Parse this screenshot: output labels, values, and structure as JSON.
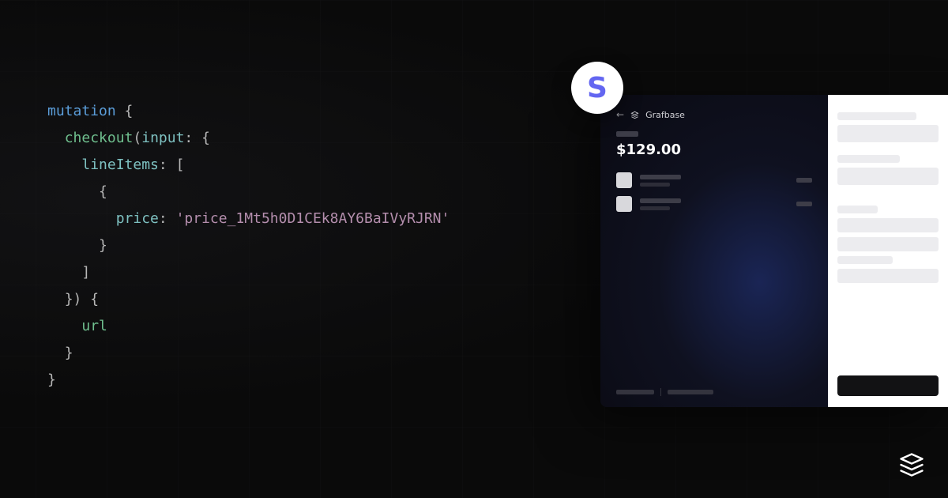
{
  "code": {
    "keyword_mutation": "mutation",
    "fn_checkout": "checkout",
    "param_input": "input",
    "key_lineItems": "lineItems",
    "key_price": "price",
    "val_priceId": "'price_1Mt5h0D1CEk8AY6BaIVyRJRN'",
    "field_url": "url"
  },
  "badge": {
    "letter": "S"
  },
  "preview": {
    "merchant": "Grafbase",
    "price": "$129.00"
  }
}
